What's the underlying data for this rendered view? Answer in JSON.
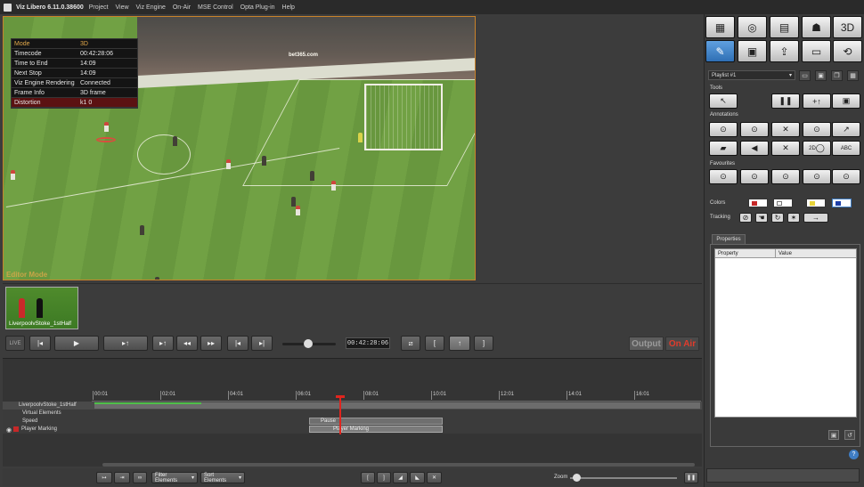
{
  "window": {
    "title": "Viz Libero 6.11.0.38600"
  },
  "menu": [
    "Project",
    "View",
    "Viz Engine",
    "On-Air",
    "MSE Control",
    "Opta Plug-in",
    "Help"
  ],
  "viewer": {
    "editor_mode_label": "Editor Mode",
    "info": [
      {
        "key": "Mode",
        "value": "3D"
      },
      {
        "key": "Timecode",
        "value": "00:42:28:06"
      },
      {
        "key": "Time to End",
        "value": "14:09"
      },
      {
        "key": "Next Stop",
        "value": "14:09"
      },
      {
        "key": "Viz Engine Rendering",
        "value": "Connected"
      },
      {
        "key": "Frame Info",
        "value": "3D frame"
      },
      {
        "key": "Distortion",
        "value": "k1    0"
      }
    ],
    "ad_board": "bet365.com"
  },
  "bin": {
    "clip_label": "LiverpoolvStoke_1stHalf"
  },
  "transport": {
    "live_label": "LIVE",
    "timecode": "00:42:28:06",
    "output_label": "Output",
    "onair_label": "On Air",
    "scrub_position": 0.48
  },
  "timeline": {
    "ticks": [
      "00:01",
      "02:01",
      "04:01",
      "06:01",
      "08:01",
      "10:01",
      "12:01",
      "14:01",
      "16:01"
    ],
    "tracks": [
      {
        "name": "LiverpoolvStoke_1stHalf"
      },
      {
        "name": "Virtual Elements"
      },
      {
        "name": "Speed"
      },
      {
        "name": "Player Marking"
      }
    ],
    "pause_label": "Pause",
    "marking_label": "Player Marking",
    "filter_label": "Filter Elements",
    "sort_label": "Sort Elements",
    "zoom_label": "Zoom",
    "zoom_level": 0.06
  },
  "right_panel": {
    "playlist_value": "Playlist #1",
    "tools_label": "Tools",
    "annotations_label": "Annotations",
    "favourites_label": "Favourites",
    "colors_label": "Colors",
    "tracking_label": "Tracking",
    "properties_tab": "Properties",
    "properties_columns": [
      "Property",
      "Value"
    ],
    "help_label": "?",
    "ann_2d_label": "2D",
    "ann_text_label": "ABC"
  },
  "colors": {
    "accent_orange": "#c9822a",
    "onair_red": "#e03c2c",
    "selected_blue": "#2f6fb4",
    "playhead_red": "#e0251e",
    "swatch_1": "#c62828",
    "swatch_2": "#ffffff",
    "swatch_3": "#e8d43a",
    "swatch_4": "#1e3fa8"
  }
}
